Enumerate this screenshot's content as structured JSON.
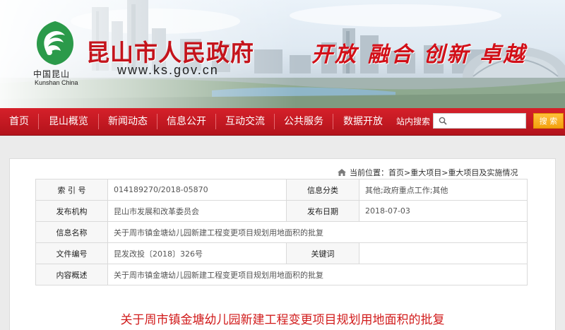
{
  "header": {
    "logo_text_cn": "中国昆山",
    "logo_text_en": "Kunshan China",
    "site_title": "昆山市人民政府",
    "site_url": "www.ks.gov.cn",
    "slogan": "开放 融合 创新 卓越"
  },
  "nav": {
    "items": [
      {
        "label": "首页"
      },
      {
        "label": "昆山概览"
      },
      {
        "label": "新闻动态"
      },
      {
        "label": "信息公开"
      },
      {
        "label": "互动交流"
      },
      {
        "label": "公共服务"
      },
      {
        "label": "数据开放"
      }
    ],
    "search_label": "站内搜索",
    "search_value": "",
    "search_button": "搜 索"
  },
  "breadcrumb": {
    "prefix": "当前位置：",
    "items": [
      "首页",
      "重大项目",
      "重大项目及实施情况"
    ],
    "separator": ">"
  },
  "meta": {
    "index_label": "索 引 号",
    "index_value": "014189270/2018-05870",
    "category_label": "信息分类",
    "category_value": "其他;政府重点工作;其他",
    "publisher_label": "发布机构",
    "publisher_value": "昆山市发展和改革委员会",
    "date_label": "发布日期",
    "date_value": "2018-07-03",
    "name_label": "信息名称",
    "name_value": "关于周市镇金塘幼儿园新建工程变更项目规划用地面积的批复",
    "docno_label": "文件编号",
    "docno_value": "昆发改投〔2018〕326号",
    "keywords_label": "关键词",
    "keywords_value": "",
    "summary_label": "内容概述",
    "summary_value": "关于周市镇金塘幼儿园新建工程变更项目规划用地面积的批复"
  },
  "document": {
    "title": "关于周市镇金塘幼儿园新建工程变更项目规划用地面积的批复"
  },
  "colors": {
    "brand_red": "#c4141c",
    "nav_red": "#c41820",
    "search_button": "#f3a00e",
    "title_red": "#d11b1b"
  }
}
